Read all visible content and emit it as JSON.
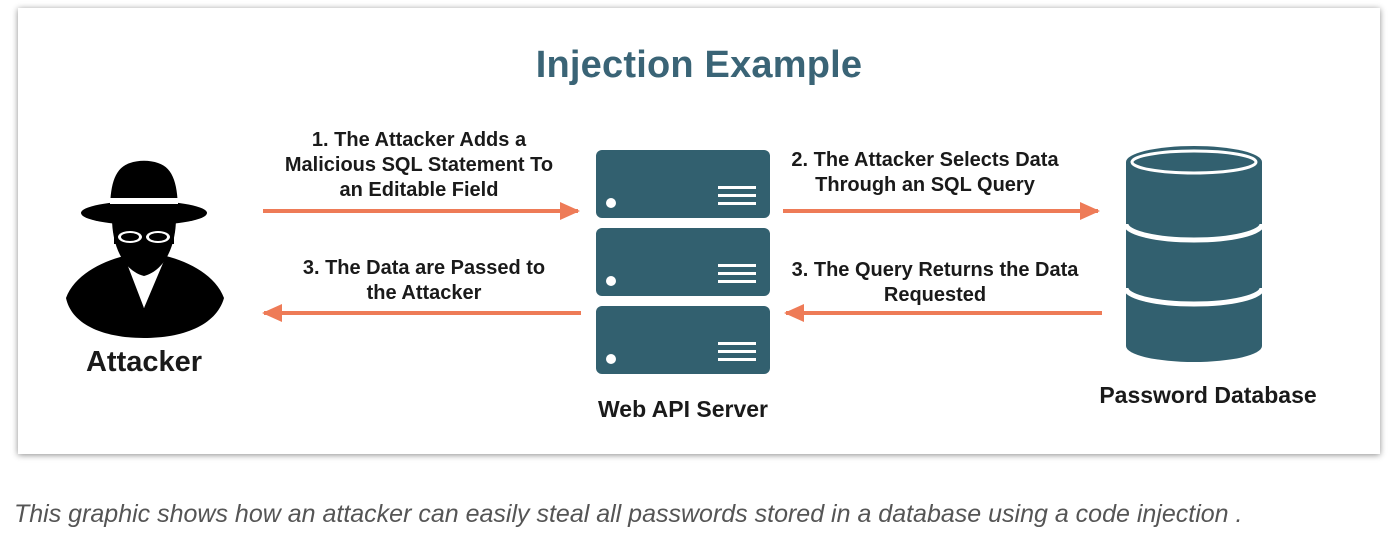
{
  "diagram": {
    "title": "Injection Example",
    "nodes": {
      "attacker": {
        "label": "Attacker",
        "icon": "hacker-icon"
      },
      "server": {
        "label": "Web API Server",
        "icon": "server-stack-icon"
      },
      "database": {
        "label": "Password Database",
        "icon": "database-icon"
      }
    },
    "steps": {
      "step1": {
        "line1": "1. The Attacker Adds a",
        "line2": "Malicious SQL Statement To",
        "line3": "an Editable Field"
      },
      "step2": {
        "line1": "2. The Attacker Selects Data",
        "line2": "Through an SQL Query"
      },
      "step3_query": {
        "line1": "3. The Query Returns the Data",
        "line2": "Requested"
      },
      "step3_pass": {
        "line1": "3. The Data are Passed to",
        "line2": "the Attacker"
      }
    },
    "colors": {
      "title": "#3a6476",
      "arrow": "#ee7b57",
      "server": "#32606f",
      "database": "#32606f",
      "attacker": "#000000"
    }
  },
  "caption": "This graphic shows how an attacker can easily steal all passwords stored in a database using a code injection ."
}
